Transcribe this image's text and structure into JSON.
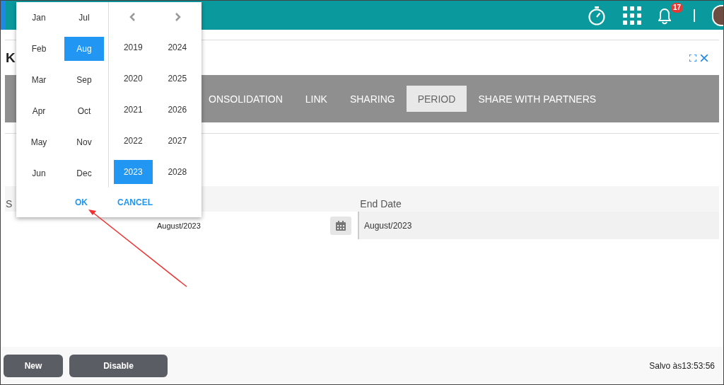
{
  "header": {
    "notification_count": "17"
  },
  "dialog": {
    "title": "K",
    "tabs": [
      {
        "label": "ONSOLIDATION",
        "selected": false
      },
      {
        "label": "LINK",
        "selected": false
      },
      {
        "label": "SHARING",
        "selected": false
      },
      {
        "label": "PERIOD",
        "selected": true
      },
      {
        "label": "SHARE WITH PARTNERS",
        "selected": false
      }
    ]
  },
  "form": {
    "start_label": "S",
    "start_value": "August/2023",
    "end_label": "End Date",
    "end_value": "August/2023"
  },
  "footer": {
    "buttons": [
      "New",
      "Disable"
    ],
    "status": "Salvo às13:53:56"
  },
  "month_picker": {
    "months": [
      {
        "label": "Jan",
        "selected": false
      },
      {
        "label": "Feb",
        "selected": false
      },
      {
        "label": "Mar",
        "selected": false
      },
      {
        "label": "Apr",
        "selected": false
      },
      {
        "label": "May",
        "selected": false
      },
      {
        "label": "Jun",
        "selected": false
      },
      {
        "label": "Jul",
        "selected": false
      },
      {
        "label": "Aug",
        "selected": true
      },
      {
        "label": "Sep",
        "selected": false
      },
      {
        "label": "Oct",
        "selected": false
      },
      {
        "label": "Nov",
        "selected": false
      },
      {
        "label": "Dec",
        "selected": false
      }
    ],
    "years": [
      {
        "label": "2019",
        "selected": false
      },
      {
        "label": "2020",
        "selected": false
      },
      {
        "label": "2021",
        "selected": false
      },
      {
        "label": "2022",
        "selected": false
      },
      {
        "label": "2023",
        "selected": true
      },
      {
        "label": "2024",
        "selected": false
      },
      {
        "label": "2025",
        "selected": false
      },
      {
        "label": "2026",
        "selected": false
      },
      {
        "label": "2027",
        "selected": false
      },
      {
        "label": "2028",
        "selected": false
      }
    ],
    "actions": [
      "OK",
      "CANCEL"
    ]
  }
}
